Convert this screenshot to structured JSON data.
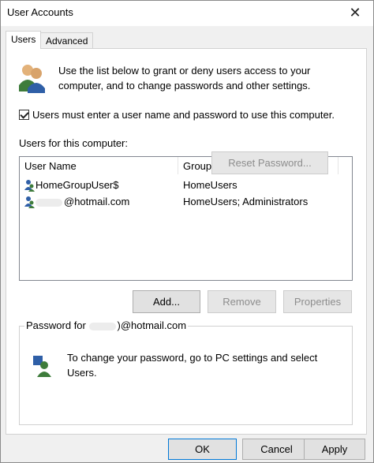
{
  "window": {
    "title": "User Accounts",
    "close_glyph": "✕"
  },
  "tabs": [
    {
      "label": "Users",
      "selected": true
    },
    {
      "label": "Advanced",
      "selected": false
    }
  ],
  "intro": {
    "icon": "users-icon",
    "text": "Use the list below to grant or deny users access to your computer, and to change passwords and other settings."
  },
  "require_password": {
    "label": "Users must enter a user name and password to use this computer.",
    "checked": true
  },
  "users_list": {
    "label": "Users for this computer:",
    "columns": [
      "User Name",
      "Group"
    ],
    "rows": [
      {
        "name": "HomeGroupUser$",
        "group": "HomeUsers"
      },
      {
        "name": "@hotmail.com",
        "group": "HomeUsers; Administrators"
      }
    ]
  },
  "buttons": {
    "add": "Add...",
    "remove": "Remove",
    "properties": "Properties"
  },
  "password": {
    "legend_prefix": "Password for",
    "legend_account": ")@hotmail.com",
    "text": "To change your password, go to PC settings and select Users.",
    "reset": "Reset Password..."
  },
  "dialog_buttons": {
    "ok": "OK",
    "cancel": "Cancel",
    "apply": "Apply"
  }
}
